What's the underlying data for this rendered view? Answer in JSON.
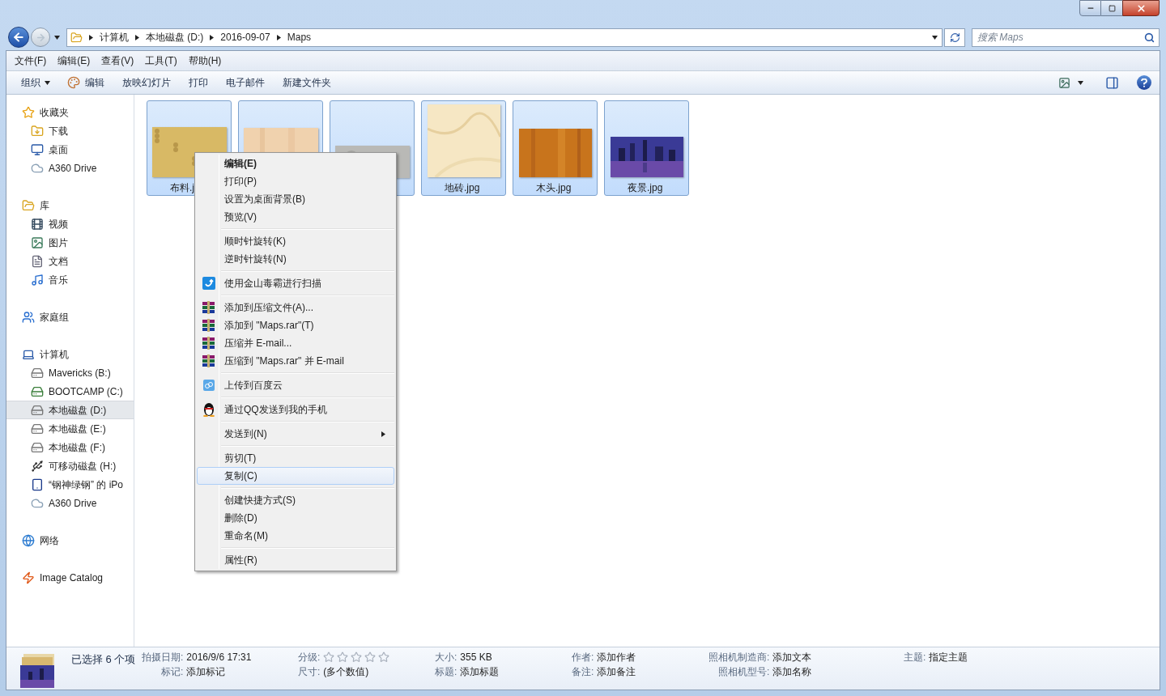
{
  "address": {
    "breadcrumbs": [
      "计算机",
      "本地磁盘 (D:)",
      "2016-09-07",
      "Maps"
    ]
  },
  "search": {
    "placeholder": "搜索 Maps"
  },
  "menu_bar": [
    "文件(F)",
    "编辑(E)",
    "查看(V)",
    "工具(T)",
    "帮助(H)"
  ],
  "toolbar": [
    {
      "label": "组织",
      "kind": "dropdown"
    },
    {
      "label": "编辑",
      "kind": "paint"
    },
    {
      "label": "放映幻灯片",
      "kind": "plain"
    },
    {
      "label": "打印",
      "kind": "plain"
    },
    {
      "label": "电子邮件",
      "kind": "plain"
    },
    {
      "label": "新建文件夹",
      "kind": "plain"
    }
  ],
  "sidebar": [
    {
      "label": "收藏夹",
      "kind": "favorites",
      "selected": false,
      "children": [
        {
          "label": "下载",
          "kind": "download",
          "selected": false
        },
        {
          "label": "桌面",
          "kind": "desktop",
          "selected": false
        },
        {
          "label": "A360 Drive",
          "kind": "cloud",
          "selected": false
        }
      ]
    },
    {
      "label": "库",
      "kind": "library",
      "selected": false,
      "children": [
        {
          "label": "视频",
          "kind": "video",
          "selected": false
        },
        {
          "label": "图片",
          "kind": "pictures",
          "selected": false
        },
        {
          "label": "文档",
          "kind": "documents",
          "selected": false
        },
        {
          "label": "音乐",
          "kind": "music",
          "selected": false
        }
      ]
    },
    {
      "label": "家庭组",
      "kind": "homegroup",
      "selected": false
    },
    {
      "label": "计算机",
      "kind": "computer",
      "selected": false,
      "children": [
        {
          "label": "Mavericks (B:)",
          "kind": "drive",
          "selected": false
        },
        {
          "label": "BOOTCAMP (C:)",
          "kind": "system-drive",
          "selected": false
        },
        {
          "label": "本地磁盘 (D:)",
          "kind": "drive",
          "selected": true
        },
        {
          "label": "本地磁盘 (E:)",
          "kind": "drive",
          "selected": false
        },
        {
          "label": "本地磁盘 (F:)",
          "kind": "drive",
          "selected": false
        },
        {
          "label": "可移动磁盘 (H:)",
          "kind": "removable",
          "selected": false
        },
        {
          "label": "“钢神绿钢” 的 iPo",
          "kind": "device",
          "selected": false
        },
        {
          "label": "A360 Drive",
          "kind": "cloud",
          "selected": false
        }
      ]
    },
    {
      "label": "网络",
      "kind": "network",
      "selected": false
    },
    {
      "label": "Image Catalog",
      "kind": "catalog",
      "selected": false
    }
  ],
  "files": [
    {
      "name": "布料.j",
      "selected": true
    },
    {
      "selected": true
    },
    {
      "selected": true
    },
    {
      "name": "地砖.jpg",
      "selected": true
    },
    {
      "name": "木头.jpg",
      "selected": true
    },
    {
      "name": "夜景.jpg",
      "selected": true
    }
  ],
  "context_menu": [
    [
      {
        "label": "编辑(E)",
        "kind": "default",
        "selected": false
      },
      {
        "label": "打印(P)",
        "kind": "plain",
        "selected": false
      },
      {
        "label": "设置为桌面背景(B)",
        "kind": "plain",
        "selected": false
      },
      {
        "label": "预览(V)",
        "kind": "plain",
        "selected": false
      }
    ],
    [
      {
        "label": "顺时针旋转(K)",
        "kind": "plain",
        "selected": false
      },
      {
        "label": "逆时针旋转(N)",
        "kind": "plain",
        "selected": false
      }
    ],
    [
      {
        "label": "使用金山毒霸进行扫描",
        "kind": "scan",
        "selected": false
      }
    ],
    [
      {
        "label": "添加到压缩文件(A)...",
        "kind": "archive",
        "selected": false
      },
      {
        "label": "添加到 \"Maps.rar\"(T)",
        "kind": "archive",
        "selected": false
      },
      {
        "label": "压缩并 E-mail...",
        "kind": "archive",
        "selected": false
      },
      {
        "label": "压缩到 \"Maps.rar\" 并 E-mail",
        "kind": "archive",
        "selected": false
      }
    ],
    [
      {
        "label": "上传到百度云",
        "kind": "cloud",
        "selected": false
      }
    ],
    [
      {
        "label": "通过QQ发送到我的手机",
        "kind": "qq",
        "selected": false
      }
    ],
    [
      {
        "label": "发送到(N)",
        "kind": "submenu",
        "selected": false
      }
    ],
    [
      {
        "label": "剪切(T)",
        "kind": "plain",
        "selected": false
      },
      {
        "label": "复制(C)",
        "kind": "plain",
        "selected": true
      }
    ],
    [
      {
        "label": "创建快捷方式(S)",
        "kind": "plain",
        "selected": false
      },
      {
        "label": "删除(D)",
        "kind": "plain",
        "selected": false
      },
      {
        "label": "重命名(M)",
        "kind": "plain",
        "selected": false
      }
    ],
    [
      {
        "label": "属性(R)",
        "kind": "plain",
        "selected": false
      }
    ]
  ],
  "details": {
    "title": "已选择 6 个项",
    "columns": [
      [
        {
          "label": "拍摄日期:",
          "kind": "text",
          "value": "2016/9/6 17:31"
        },
        {
          "label": "标记:",
          "kind": "text",
          "value": "添加标记"
        }
      ],
      [
        {
          "label": "分级:",
          "kind": "rating",
          "stars": 0
        },
        {
          "label": "尺寸:",
          "kind": "text",
          "value": "(多个数值)"
        }
      ],
      [
        {
          "label": "大小:",
          "kind": "text",
          "value": "355 KB"
        },
        {
          "label": "标题:",
          "kind": "text",
          "value": "添加标题"
        }
      ],
      [
        {
          "label": "作者:",
          "kind": "text",
          "value": "添加作者"
        },
        {
          "label": "备注:",
          "kind": "text",
          "value": "添加备注"
        }
      ],
      [
        {
          "label": "照相机制造商:",
          "kind": "text",
          "value": "添加文本"
        },
        {
          "label": "照相机型号:",
          "kind": "text",
          "value": "添加名称"
        }
      ],
      [
        {
          "label": "主题:",
          "kind": "text",
          "value": "指定主题"
        }
      ]
    ]
  }
}
